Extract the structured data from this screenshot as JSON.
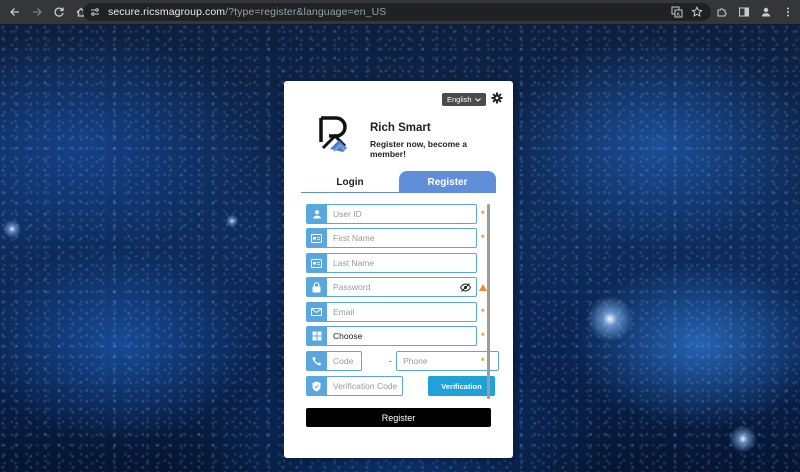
{
  "browser": {
    "url_host": "secure.ricsmagroup.com",
    "url_rest": "/?type=register&language=en_US"
  },
  "card": {
    "language": "English",
    "brand": "Rich Smart",
    "tagline": "Register now, become a member!",
    "tabs": {
      "login": "Login",
      "register": "Register"
    },
    "fields": {
      "user_id": "User ID",
      "first_name": "First Name",
      "last_name": "Last Name",
      "password": "Password",
      "email": "Email",
      "choose": "Choose",
      "code": "Code",
      "phone": "Phone",
      "verification_code": "Verification Code"
    },
    "required_mark": "*",
    "phone_separator": "-",
    "verification_button": "Verification",
    "submit": "Register"
  },
  "colors": {
    "accent": "#5f8fd8",
    "field_icon": "#5aa7e0",
    "required": "#f08a2c",
    "verify_button": "#1ea2d9"
  }
}
